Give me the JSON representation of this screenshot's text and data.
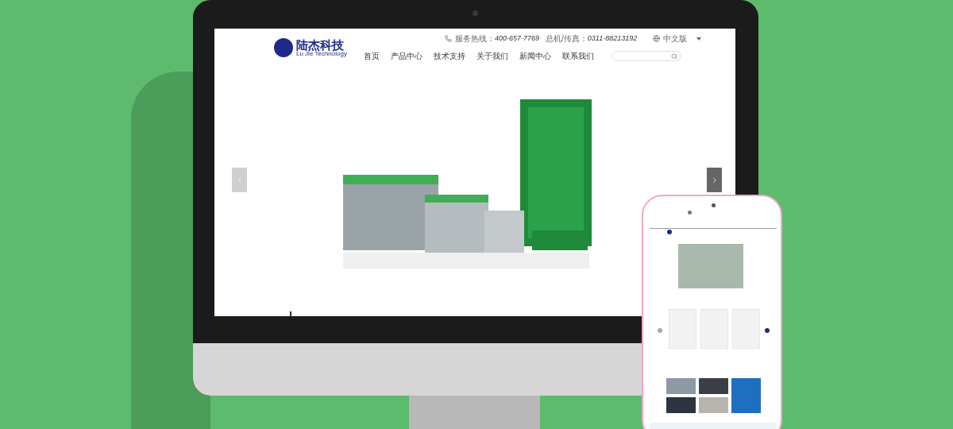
{
  "site": {
    "brand": {
      "name": "陆杰科技",
      "tagline": "Lu Jie Technology"
    },
    "contact": [
      {
        "label": "服务热线：",
        "value": "400-657-7769"
      },
      {
        "label": "总机/传真：",
        "value": "0311-88213192"
      }
    ],
    "language": "中文版",
    "nav": [
      {
        "label": "首页"
      },
      {
        "label": "产品中心"
      },
      {
        "label": "技术支持"
      },
      {
        "label": "关于我们"
      },
      {
        "label": "新闻中心"
      },
      {
        "label": "联系我们"
      }
    ]
  }
}
